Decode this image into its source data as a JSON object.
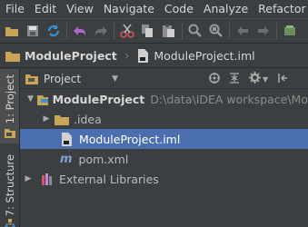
{
  "menu": [
    "File",
    "Edit",
    "View",
    "Navigate",
    "Code",
    "Analyze",
    "Refactor"
  ],
  "navbar": {
    "project": "ModuleProject",
    "file": "ModuleProject.iml"
  },
  "sidebar": {
    "tab_project": "1: Project",
    "tab_structure": "7: Structure"
  },
  "panel": {
    "view_label": "Project"
  },
  "tree": {
    "root_name": "ModuleProject",
    "root_path": "D:\\data\\IDEA workspace\\Mo",
    "idea": ".idea",
    "iml": "ModuleProject.iml",
    "pom": "pom.xml",
    "libs": "External Libraries"
  },
  "colors": {
    "selection": "#4b6eaf",
    "folder": "#c9a55c",
    "maven": "#7fa2ce"
  }
}
